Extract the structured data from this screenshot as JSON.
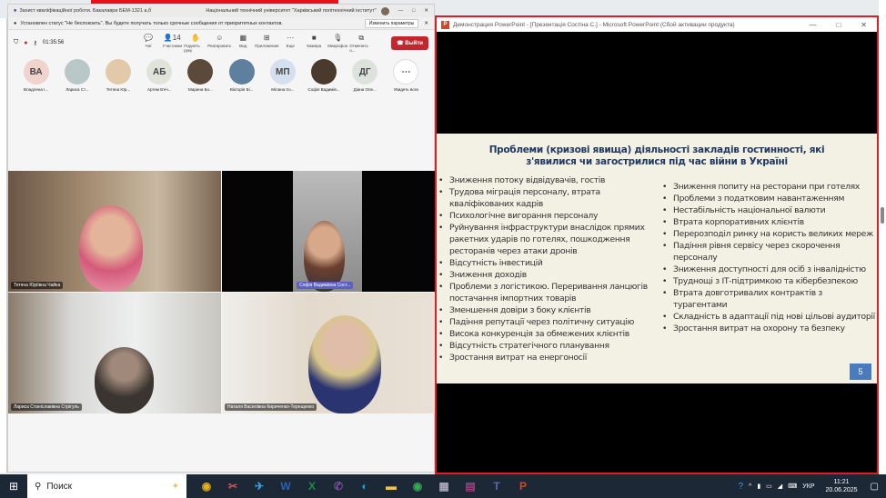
{
  "teams": {
    "title": "Захист кваліфікаційної роботи. Бакалаври БЕМ-1321 а,б",
    "org": "Національний технічний університет \"Харківський політехнічний інститут\"",
    "notification": "Установлен статус \"Не беспокоить\". Вы будете получать только срочные сообщения от приоритетных контактов.",
    "notification_button": "Изменить параметры",
    "timer": "01:35:56",
    "tools": [
      {
        "icon": "chat-icon",
        "label": "Чат",
        "glyph": "💬"
      },
      {
        "icon": "people-icon",
        "label": "Участники",
        "glyph": "👤14"
      },
      {
        "icon": "hand-icon",
        "label": "Поднять руку",
        "glyph": "✋"
      },
      {
        "icon": "emoji-icon",
        "label": "Реагировать",
        "glyph": "☺"
      },
      {
        "icon": "grid-icon",
        "label": "Вид",
        "glyph": "▦"
      },
      {
        "icon": "apps-icon",
        "label": "Приложения",
        "glyph": "⊞"
      },
      {
        "icon": "more-icon",
        "label": "Еще",
        "glyph": "⋯"
      },
      {
        "icon": "camera-icon",
        "label": "Камера",
        "glyph": "■"
      },
      {
        "icon": "mic-off-icon",
        "label": "Микрофон",
        "glyph": "🎙"
      },
      {
        "icon": "share-icon",
        "label": "Отменить о...",
        "glyph": "⧉"
      }
    ],
    "leave": "Выйти",
    "participants": [
      {
        "initials": "ВА",
        "name": "Владлена І...",
        "color": "#f1d3cd"
      },
      {
        "initials": "",
        "name": "Лариса Ст...",
        "color": "#b9c7c9"
      },
      {
        "initials": "",
        "name": "Тетяна Юр...",
        "color": "#e2c9a8"
      },
      {
        "initials": "АБ",
        "name": "Артем Б'еч...",
        "color": "#dfe3d9"
      },
      {
        "initials": "",
        "name": "Марина Бо...",
        "color": "#5b4a3a"
      },
      {
        "initials": "",
        "name": "Вікторія Бі...",
        "color": "#5f7f9f"
      },
      {
        "initials": "МП",
        "name": "Мілана Іго...",
        "color": "#d4e0ee"
      },
      {
        "initials": "",
        "name": "Софія Вадимів...",
        "color": "#4a3a2e"
      },
      {
        "initials": "ДГ",
        "name": "Діана Оле...",
        "color": "#dde3dc"
      },
      {
        "initials": "⋯",
        "name": "Увидеть всех",
        "color": "#ffffff"
      }
    ],
    "tiles": [
      "Тетяна Юріївна Чайка",
      "Софія Вадимівна Сост...",
      "Лариса Станіславівна Стрігуль",
      "Наталя Василівна Кириченко-Терещенко"
    ]
  },
  "ppt": {
    "title": "Демонстрация PowerPoint - [Презентація Состіна С.] - Microsoft PowerPoint (Сбой активации продукта)",
    "slide": {
      "title": "Проблеми (кризові явища) діяльності  закладів гостинності,  які з'явилися чи загострилися  під час війни в Україні",
      "left": [
        "Зниження потоку відвідувачів, гостів",
        "Трудова міграція персоналу, втрата кваліфікованих кадрів",
        "Психологічне вигорання персоналу",
        "Руйнування інфраструктури внаслідок прямих ракетних ударів по готелях, пошкодження ресторанів через атаки дронів",
        "Відсутність інвестицій",
        "Зниження  доходів",
        "Проблеми з логістикою. Переривання  ланцюгів постачання імпортних товарів",
        "Зменшення  довіри з боку клієнтів",
        "Падіння репутації через політичну ситуацію",
        "Висока конкуренція за обмежених клієнтів",
        "Відсутність стратегічного планування",
        "Зростання витрат на енергоносії"
      ],
      "right": [
        "Зниження попиту на ресторани при готелях",
        "Проблеми з податковим навантаженням",
        "Нестабільність національної валюти",
        "Втрата корпоративних клієнтів",
        "Перерозподіл ринку на користь великих мереж",
        "Падіння рівня сервісу через скорочення персоналу",
        "Зниження  доступності для осіб з інвалідністю",
        "Труднощі з ІТ-підтримкою та кібербезпекою",
        "Втрата довготривалих контрактів з турагентами",
        "Складність в адаптації під нові цільові аудиторії",
        "Зростання витрат на охорону та безпеку"
      ],
      "number": "5"
    }
  },
  "taskbar": {
    "search": "Поиск",
    "apps": [
      {
        "icon": "chrome-icon",
        "glyph": "◉",
        "color": "#e8b21c"
      },
      {
        "icon": "app-icon",
        "glyph": "✂",
        "color": "#d9534f"
      },
      {
        "icon": "telegram-icon",
        "glyph": "✈",
        "color": "#2aa3e0"
      },
      {
        "icon": "word-icon",
        "glyph": "W",
        "color": "#2b5fb4"
      },
      {
        "icon": "excel-icon",
        "glyph": "X",
        "color": "#1f8a4c"
      },
      {
        "icon": "viber-icon",
        "glyph": "✆",
        "color": "#7b519d"
      },
      {
        "icon": "edge-icon",
        "glyph": "◐",
        "color": "#1fa0d8"
      },
      {
        "icon": "explorer-icon",
        "glyph": "▬",
        "color": "#f2c14e"
      },
      {
        "icon": "chrome-icon",
        "glyph": "◉",
        "color": "#34a853"
      },
      {
        "icon": "calculator-icon",
        "glyph": "▦",
        "color": "#aab"
      },
      {
        "icon": "winrar-icon",
        "glyph": "▤",
        "color": "#a04080"
      },
      {
        "icon": "teams-icon",
        "glyph": "T",
        "color": "#6264a7"
      },
      {
        "icon": "powerpoint-icon",
        "glyph": "P",
        "color": "#d24726"
      }
    ],
    "lang": "УКР",
    "time": "11:21",
    "date": "20.06.2025"
  }
}
